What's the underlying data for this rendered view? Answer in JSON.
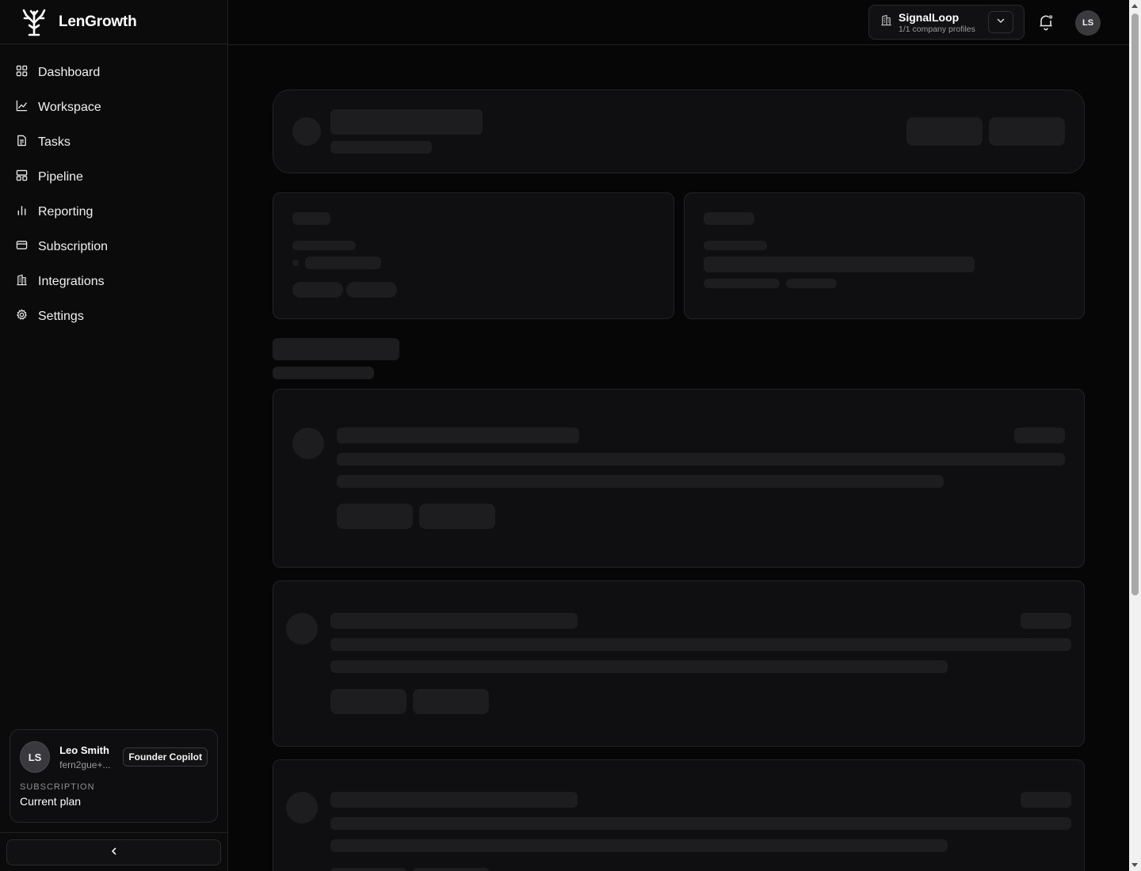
{
  "brand": {
    "name": "LenGrowth",
    "logo_icon": "tree-logo-icon"
  },
  "nav": [
    {
      "label": "Dashboard",
      "icon": "grid-icon"
    },
    {
      "label": "Workspace",
      "icon": "line-chart-icon"
    },
    {
      "label": "Tasks",
      "icon": "document-icon"
    },
    {
      "label": "Pipeline",
      "icon": "layout-icon"
    },
    {
      "label": "Reporting",
      "icon": "bar-chart-icon"
    },
    {
      "label": "Subscription",
      "icon": "credit-card-icon"
    },
    {
      "label": "Integrations",
      "icon": "building-icon"
    },
    {
      "label": "Settings",
      "icon": "gear-icon"
    }
  ],
  "user": {
    "initials": "LS",
    "name": "Leo Smith",
    "email": "fern2gue+...",
    "plan_badge": "Founder Copilot",
    "subscription_label": "SUBSCRIPTION",
    "subscription_value": "Current plan"
  },
  "topbar": {
    "company_name": "SignalLoop",
    "company_sub": "1/1 company profiles",
    "avatar_initials": "LS"
  },
  "colors": {
    "background": "#060607",
    "sidebar": "#0b0b0c",
    "skeleton": "#1d1d20",
    "card": "#0f0f11"
  }
}
